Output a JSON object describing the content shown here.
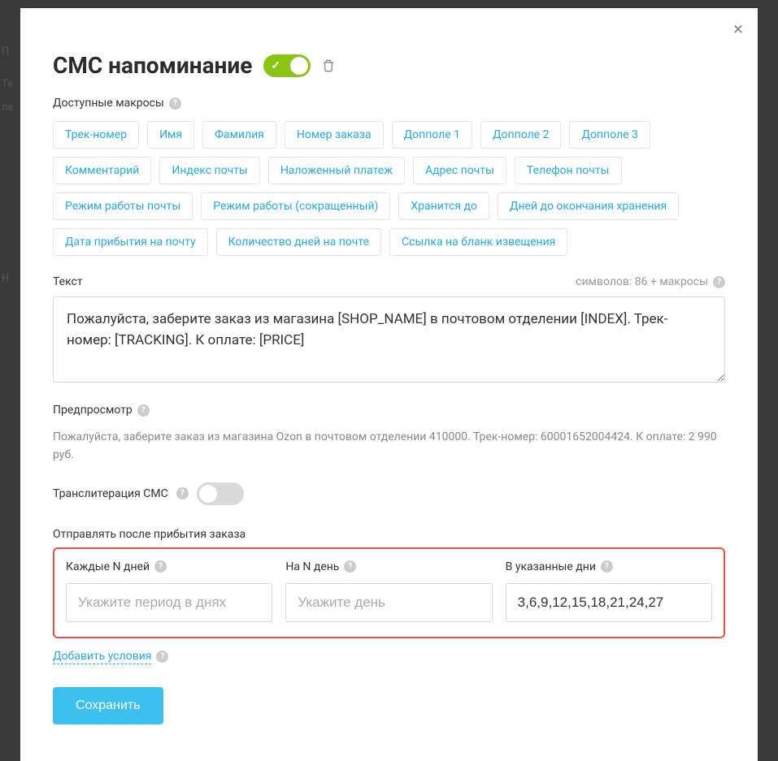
{
  "modal": {
    "title": "СМС напоминание",
    "macros_label": "Доступные макросы",
    "macros": [
      "Трек-номер",
      "Имя",
      "Фамилия",
      "Номер заказа",
      "Допполе 1",
      "Допполе 2",
      "Допполе 3",
      "Комментарий",
      "Индекс почты",
      "Наложенный платеж",
      "Адрес почты",
      "Телефон почты",
      "Режим работы почты",
      "Режим работы (сокращенный)",
      "Хранится до",
      "Дней до окончания хранения",
      "Дата прибытия на почту",
      "Количество дней на почте",
      "Ссылка на бланк извещения"
    ],
    "text_label": "Текст",
    "char_counter": "символов: 86 + макросы",
    "text_value": "Пожалуйста, заберите заказ из магазина [SHOP_NAME] в почтовом отделении [INDEX]. Трек-номер: [TRACKING]. К оплате: [PRICE]",
    "preview_label": "Предпросмотр",
    "preview_text": "Пожалуйста, заберите заказ из магазина Ozon в почтовом отделении 410000. Трек-номер: 60001652004424. К оплате: 2 990 руб.",
    "translit_label": "Транслитерация СМС",
    "send_after_label": "Отправлять после прибытия заказа",
    "fields": {
      "every_n": {
        "label": "Каждые N дней",
        "placeholder": "Укажите период в днях",
        "value": ""
      },
      "on_n": {
        "label": "На N день",
        "placeholder": "Укажите день",
        "value": ""
      },
      "specific": {
        "label": "В указанные дни",
        "placeholder": "",
        "value": "3,6,9,12,15,18,21,24,27"
      }
    },
    "add_conditions": "Добавить условия",
    "save": "Сохранить"
  }
}
